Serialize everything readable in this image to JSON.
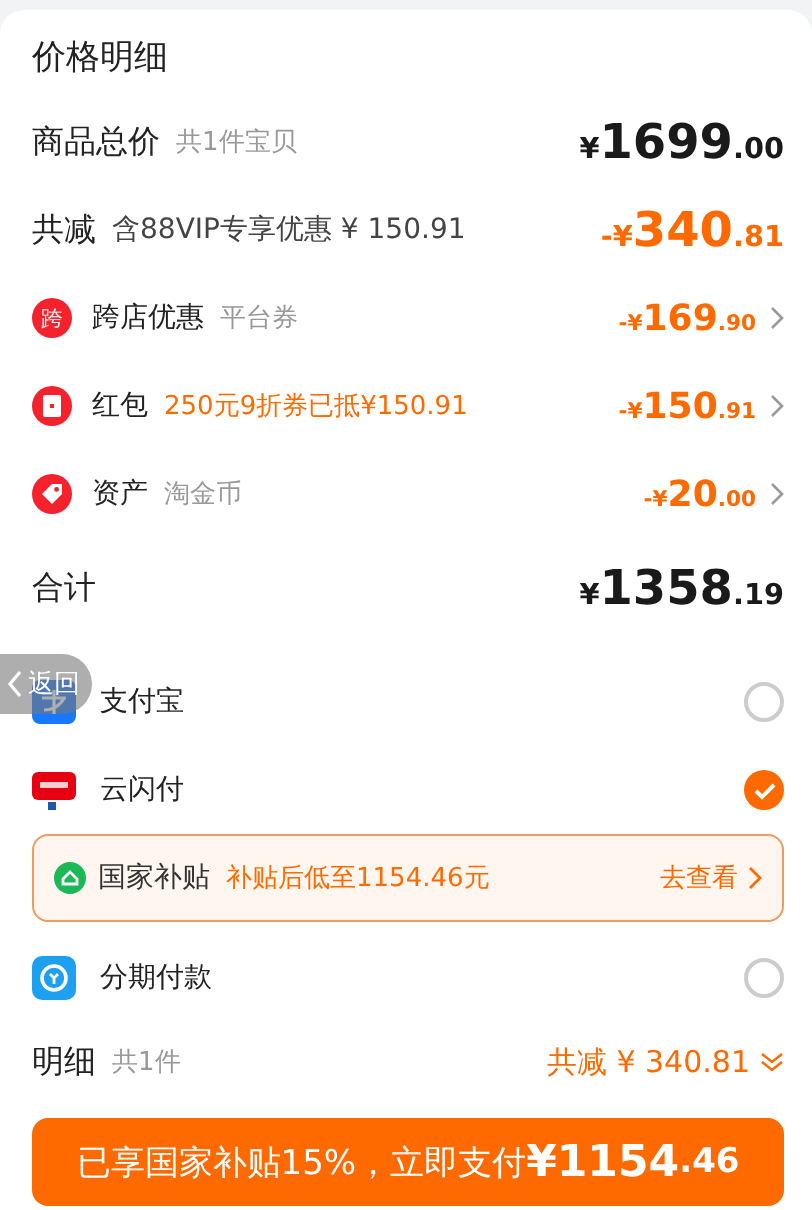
{
  "title": "价格明细",
  "summary": {
    "label": "商品总价",
    "note": "共1件宝贝",
    "amount": {
      "sign": "¥",
      "main": "1699",
      "cents": ".00"
    }
  },
  "discount": {
    "label": "共减",
    "note": "含88VIP专享优惠 ¥ 150.91",
    "amount": {
      "sign": "-¥",
      "main": "340",
      "cents": ".81"
    }
  },
  "items": [
    {
      "kind": "cross-store",
      "badge": "跨",
      "label": "跨店优惠",
      "note": "平台券",
      "highlight": false,
      "amount": {
        "sign": "-¥",
        "main": "169",
        "cents": ".90"
      }
    },
    {
      "kind": "red-packet",
      "label": "红包",
      "note": "250元9折券已抵¥150.91",
      "highlight": true,
      "amount": {
        "sign": "-¥",
        "main": "150",
        "cents": ".91"
      }
    },
    {
      "kind": "assets",
      "label": "资产",
      "note": "淘金币",
      "highlight": false,
      "amount": {
        "sign": "-¥",
        "main": "20",
        "cents": ".00"
      }
    }
  ],
  "total": {
    "label": "合计",
    "amount": {
      "sign": "¥",
      "main": "1358",
      "cents": ".19"
    }
  },
  "back_button": {
    "label": "返回"
  },
  "payment_methods": [
    {
      "kind": "alipay",
      "label": "支付宝",
      "selected": false
    },
    {
      "kind": "unionpay",
      "label": "云闪付",
      "selected": true,
      "promo": {
        "label": "国家补贴",
        "text": "补贴后低至1154.46元",
        "link": "去查看"
      }
    },
    {
      "kind": "installment",
      "label": "分期付款",
      "selected": false
    }
  ],
  "detail": {
    "label": "明细",
    "note": "共1件",
    "saving": "共减 ¥ 340.81"
  },
  "pay_button": {
    "text": "已享国家补贴15%，立即支付",
    "sign": "¥",
    "main": "1154",
    "cents": ".46"
  }
}
